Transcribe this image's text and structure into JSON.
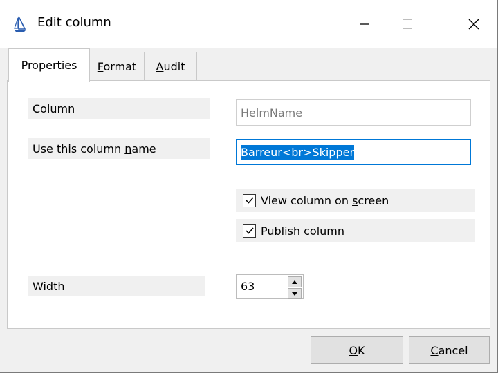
{
  "window": {
    "title": "Edit column",
    "icon": "sailboat-icon"
  },
  "tabs": [
    {
      "label": "Properties",
      "underline_char": "r",
      "active": true
    },
    {
      "label": "Format",
      "underline_char": "F",
      "active": false
    },
    {
      "label": "Audit",
      "underline_char": "A",
      "active": false
    }
  ],
  "properties": {
    "column_label": "Column",
    "column_value": "HelmName",
    "name_label_pre": "Use this column ",
    "name_label_u": "n",
    "name_label_post": "ame",
    "name_value": "Barreur<br>Skipper",
    "view_on_screen_pre": "View column on ",
    "view_on_screen_u": "s",
    "view_on_screen_post": "creen",
    "view_on_screen_checked": true,
    "publish_u": "P",
    "publish_post": "ublish column",
    "publish_checked": true,
    "width_u": "W",
    "width_post": "idth",
    "width_value": "63"
  },
  "buttons": {
    "ok_u": "O",
    "ok_post": "K",
    "cancel_u": "C",
    "cancel_post": "ancel"
  },
  "colors": {
    "selection": "#0078d7",
    "focus_border": "#0078d7"
  }
}
